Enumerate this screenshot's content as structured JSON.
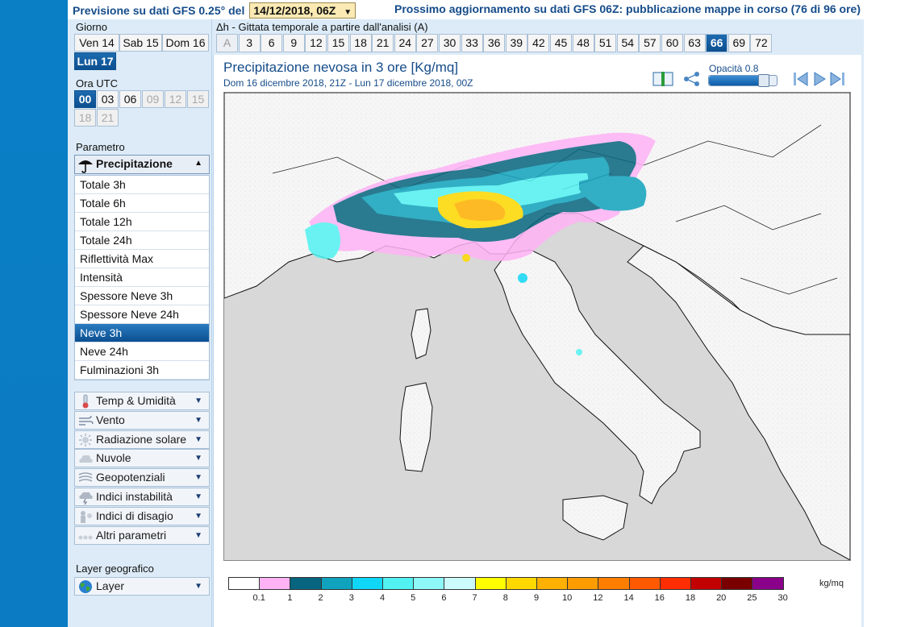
{
  "header": {
    "prefix": "Previsione su dati GFS 0.25° del",
    "run_date": "14/12/2018, 06Z",
    "next_update": "Prossimo aggiornamento su dati GFS 06Z: pubblicazione mappe in corso (76 di 96 ore)"
  },
  "sidebar": {
    "day_label": "Giorno",
    "days": [
      {
        "label": "Ven 14",
        "state": "normal"
      },
      {
        "label": "Sab 15",
        "state": "normal"
      },
      {
        "label": "Dom 16",
        "state": "normal"
      },
      {
        "label": "Lun 17",
        "state": "active"
      }
    ],
    "hour_label": "Ora UTC",
    "hours": [
      {
        "label": "00",
        "state": "active"
      },
      {
        "label": "03",
        "state": "normal"
      },
      {
        "label": "06",
        "state": "normal"
      },
      {
        "label": "09",
        "state": "disabled"
      },
      {
        "label": "12",
        "state": "disabled"
      },
      {
        "label": "15",
        "state": "disabled"
      },
      {
        "label": "18",
        "state": "disabled"
      },
      {
        "label": "21",
        "state": "disabled"
      }
    ],
    "param_label": "Parametro",
    "param_group": "Precipitazione",
    "param_items": [
      {
        "label": "Totale 3h",
        "active": false
      },
      {
        "label": "Totale 6h",
        "active": false
      },
      {
        "label": "Totale 12h",
        "active": false
      },
      {
        "label": "Totale 24h",
        "active": false
      },
      {
        "label": "Riflettività Max",
        "active": false
      },
      {
        "label": "Intensità",
        "active": false
      },
      {
        "label": "Spessore Neve 3h",
        "active": false
      },
      {
        "label": "Spessore Neve 24h",
        "active": false
      },
      {
        "label": "Neve 3h",
        "active": true
      },
      {
        "label": "Neve 24h",
        "active": false
      },
      {
        "label": "Fulminazioni 3h",
        "active": false
      }
    ],
    "groups": [
      {
        "label": "Temp & Umidità",
        "icon": "thermometer-icon"
      },
      {
        "label": "Vento",
        "icon": "wind-icon"
      },
      {
        "label": "Radiazione solare",
        "icon": "sun-icon"
      },
      {
        "label": "Nuvole",
        "icon": "cloud-icon"
      },
      {
        "label": "Geopotenziali",
        "icon": "geopotential-icon"
      },
      {
        "label": "Indici instabilità",
        "icon": "storm-cloud-icon"
      },
      {
        "label": "Indici di disagio",
        "icon": "discomfort-icon"
      },
      {
        "label": "Altri parametri",
        "icon": "dots-icon"
      }
    ],
    "layer_label": "Layer geografico",
    "layer_group": "Layer"
  },
  "timeline": {
    "label": "Δh - Gittata temporale a partire dall'analisi (A)",
    "steps": [
      "A",
      "3",
      "6",
      "9",
      "12",
      "15",
      "18",
      "21",
      "24",
      "27",
      "30",
      "33",
      "36",
      "39",
      "42",
      "45",
      "48",
      "51",
      "54",
      "57",
      "60",
      "63",
      "66",
      "69",
      "72"
    ],
    "active": "66",
    "disabled": [
      "A"
    ]
  },
  "map": {
    "title": "Precipitazione nevosa in 3 ore [Kg/mq]",
    "subtitle": "Dom 16 dicembre 2018, 21Z - Lun 17 dicembre 2018, 00Z",
    "opacity_label": "Opacità 0.8",
    "opacity_value": 0.8
  },
  "legend": {
    "unit": "kg/mq",
    "colors": [
      "#ffffff",
      "#ffb3f5",
      "#07657f",
      "#10a3bd",
      "#10d7f7",
      "#52f2f2",
      "#8ef8f8",
      "#ccfbfb",
      "#ffff00",
      "#ffd800",
      "#ffb000",
      "#ff9c00",
      "#ff7e00",
      "#ff5a00",
      "#ff2d00",
      "#c30000",
      "#7a0000",
      "#8a008a"
    ],
    "ticks": [
      "0.1",
      "1",
      "2",
      "3",
      "4",
      "5",
      "6",
      "7",
      "8",
      "9",
      "10",
      "12",
      "14",
      "16",
      "18",
      "20",
      "25",
      "30"
    ]
  },
  "colors": {
    "accent": "#154c8a",
    "active": "#0c4f8f",
    "sea": "#ececec",
    "land": "#f7f7f7"
  }
}
